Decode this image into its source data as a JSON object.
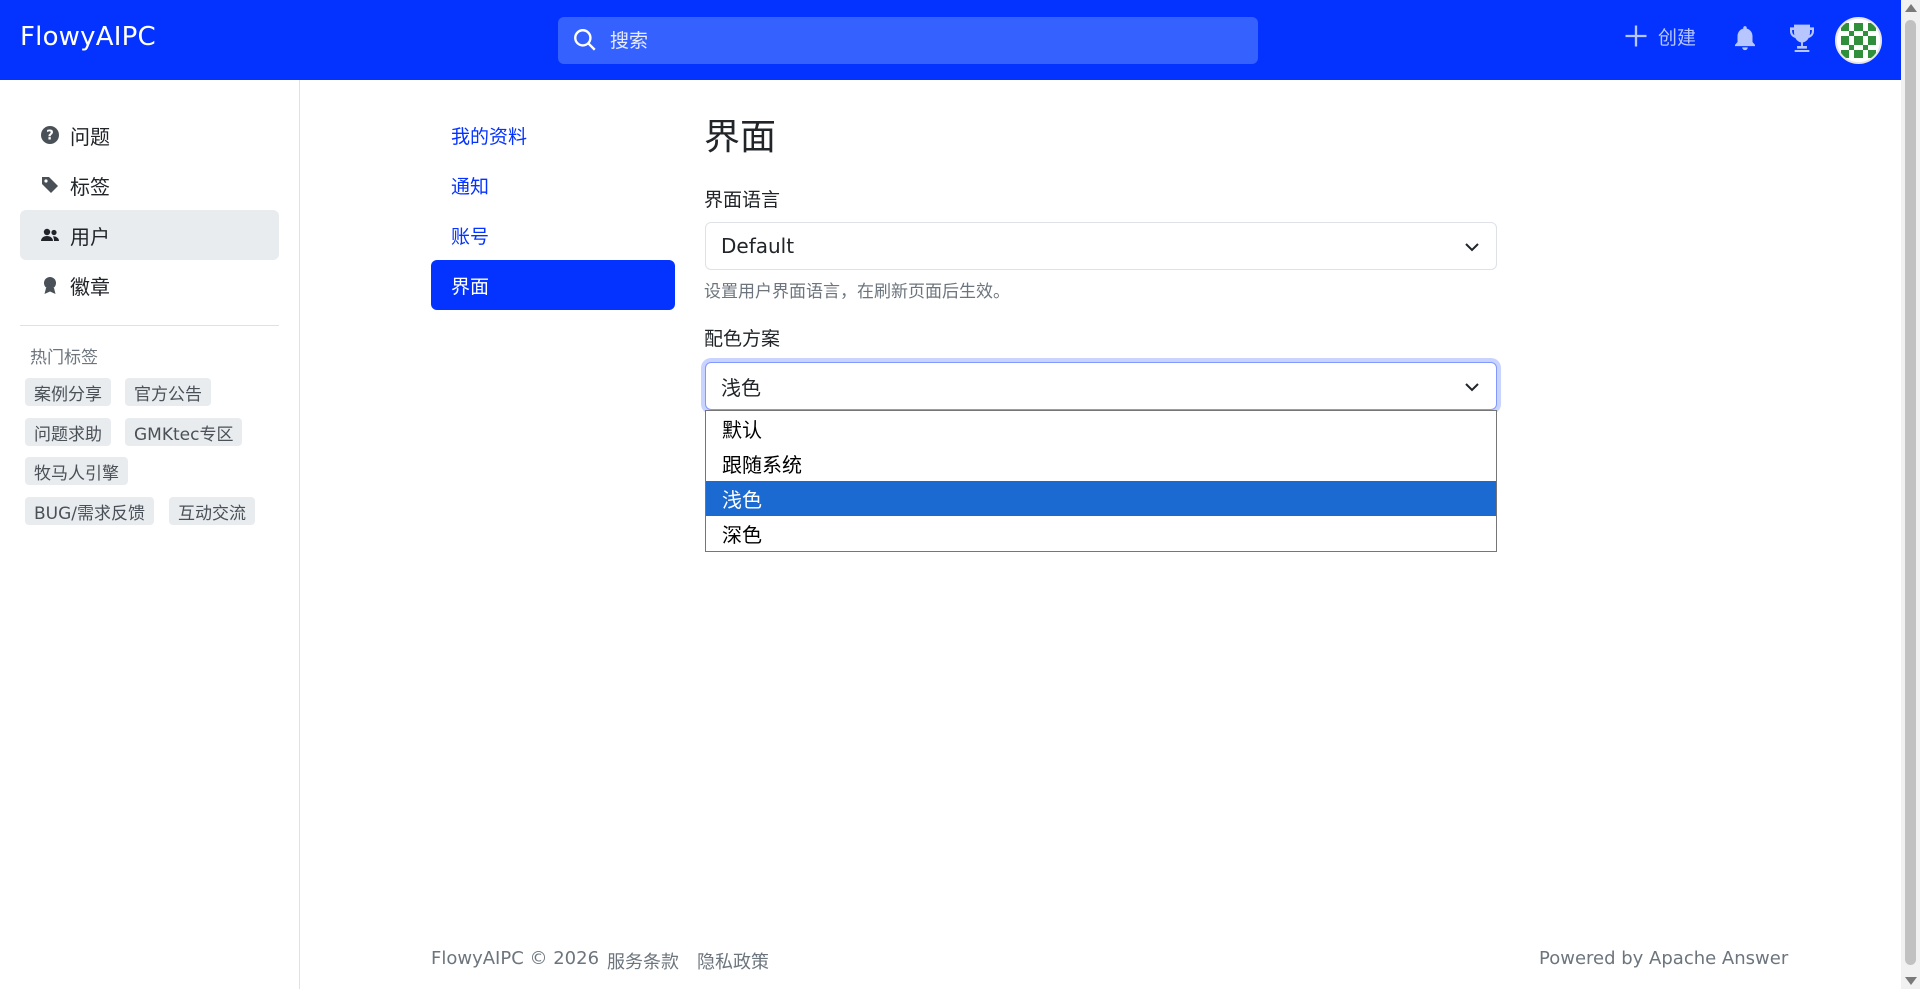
{
  "header": {
    "brand": "FlowyAIPC",
    "search_placeholder": "搜索",
    "create_label": "创建"
  },
  "sidebar": {
    "items": [
      {
        "label": "问题",
        "icon": "question-circle-icon"
      },
      {
        "label": "标签",
        "icon": "tags-icon"
      },
      {
        "label": "用户",
        "icon": "people-icon",
        "active": true
      },
      {
        "label": "徽章",
        "icon": "award-icon"
      }
    ],
    "hot_tags_title": "热门标签",
    "hot_tags": [
      "案例分享",
      "官方公告",
      "问题求助",
      "GMKtec专区",
      "牧马人引擎",
      "BUG/需求反馈",
      "互动交流"
    ]
  },
  "settings_nav": [
    {
      "label": "我的资料"
    },
    {
      "label": "通知"
    },
    {
      "label": "账号"
    },
    {
      "label": "界面",
      "active": true
    }
  ],
  "main": {
    "title": "界面",
    "language_label": "界面语言",
    "language_value": "Default",
    "language_help": "设置用户界面语言，在刷新页面后生效。",
    "color_label": "配色方案",
    "color_value": "浅色",
    "color_options": [
      "默认",
      "跟随系统",
      "浅色",
      "深色"
    ],
    "color_selected_index": 2
  },
  "footer": {
    "copyright": "FlowyAIPC © 2026",
    "terms": "服务条款",
    "privacy": "隐私政策",
    "powered": "Powered by Apache Answer"
  },
  "colors": {
    "brand": "#0433ff",
    "search_bg": "#3561ff",
    "option_selected": "#1b6ad2"
  }
}
